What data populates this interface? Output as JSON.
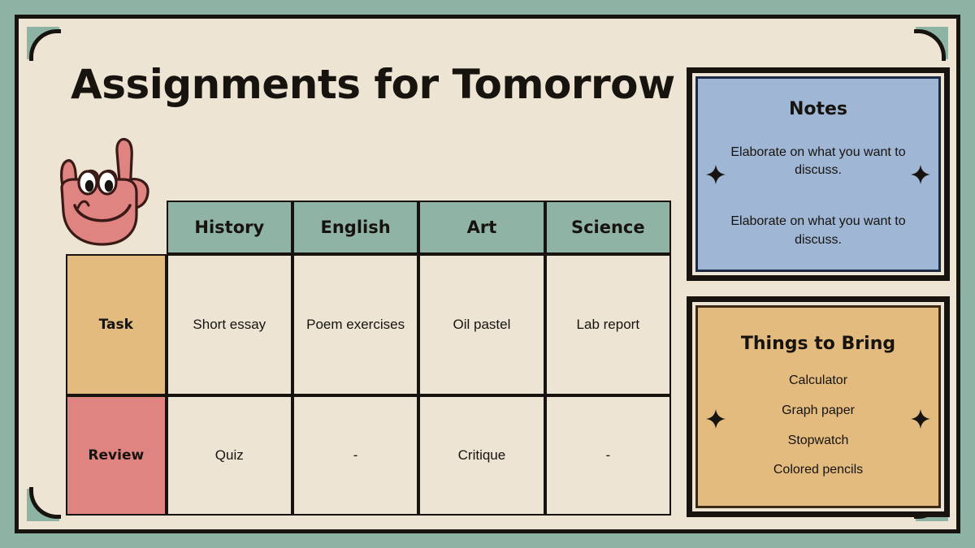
{
  "slide": {
    "title": "Assignments for Tomorrow",
    "background_color": "#8cb3a4",
    "card_color": "#ede4d3",
    "ink_color": "#17130f"
  },
  "mascot": {
    "icon": "hand-rock-on-smiley-icon",
    "fill_color": "#e08482"
  },
  "table": {
    "corner_label": "",
    "columns": [
      "History",
      "English",
      "Art",
      "Science"
    ],
    "header_color": "#8fb3a5",
    "rows": [
      {
        "label": "Task",
        "label_color": "#e3bb7e",
        "cells": [
          "Short essay",
          "Poem exercises",
          "Oil pastel",
          "Lab report"
        ]
      },
      {
        "label": "Review",
        "label_color": "#e08482",
        "cells": [
          "Quiz",
          "-",
          "Critique",
          "-"
        ]
      }
    ]
  },
  "notes_panel": {
    "title": "Notes",
    "fill_color": "#9fb6d4",
    "inner_border_color": "#1d2a46",
    "lines": [
      "Elaborate on what you want to discuss.",
      "Elaborate on what you want to discuss."
    ],
    "sparkle_icon": "four-point-star-icon"
  },
  "bring_panel": {
    "title": "Things to Bring",
    "fill_color": "#e3bb7e",
    "inner_border_color": "#3c2a16",
    "items": [
      "Calculator",
      "Graph paper",
      "Stopwatch",
      "Colored pencils"
    ],
    "sparkle_icon": "four-point-star-icon"
  }
}
